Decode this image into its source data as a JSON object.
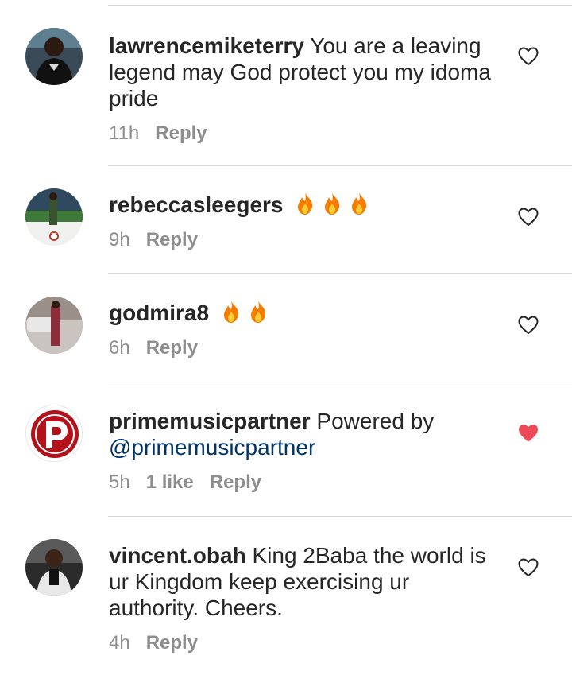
{
  "comments": [
    {
      "username": "lawrencemiketerry",
      "text": "You are a leaving legend may God protect you my idoma pride",
      "time": "11h",
      "reply": "Reply",
      "liked": false
    },
    {
      "username": "rebeccasleegers",
      "emoji": "fire-icon x3",
      "time": "9h",
      "reply": "Reply",
      "liked": false
    },
    {
      "username": "godmira8",
      "emoji": "fire-icon x2",
      "time": "6h",
      "reply": "Reply",
      "liked": false
    },
    {
      "username": "primemusicpartner",
      "text": "Powered by",
      "mention": "@primemusicpartner",
      "time": "5h",
      "likes": "1 like",
      "reply": "Reply",
      "liked": true
    },
    {
      "username": "vincent.obah",
      "text": "King 2Baba the world is ur Kingdom keep exercising ur authority. Cheers.",
      "time": "4h",
      "reply": "Reply",
      "liked": false
    }
  ],
  "colors": {
    "text": "#262626",
    "meta": "#8e8e8e",
    "mention": "#003569",
    "heart_liked": "#ed4956",
    "divider": "#d8d8d8"
  }
}
